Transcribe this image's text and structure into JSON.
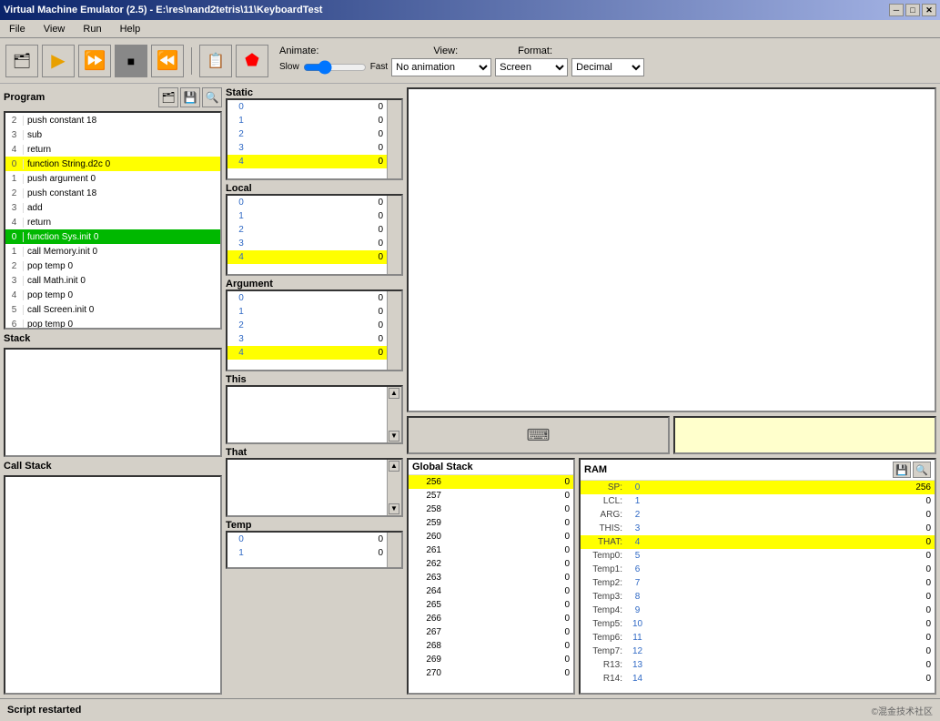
{
  "titlebar": {
    "title": "Virtual Machine Emulator (2.5) - E:\\res\\nand2tetris\\11\\KeyboardTest",
    "minimize": "─",
    "maximize": "□",
    "close": "✕"
  },
  "menu": {
    "items": [
      "File",
      "View",
      "Run",
      "Help"
    ]
  },
  "toolbar": {
    "animate_label": "Animate:",
    "view_label": "View:",
    "format_label": "Format:",
    "slow_label": "Slow",
    "fast_label": "Fast",
    "animate_options": [
      "No animation"
    ],
    "view_options": [
      "Screen"
    ],
    "format_options": [
      "Decimal"
    ]
  },
  "program": {
    "label": "Program",
    "rows": [
      {
        "num": "2",
        "content": "push    constant 18",
        "style": "normal"
      },
      {
        "num": "3",
        "content": "sub",
        "style": "normal"
      },
      {
        "num": "4",
        "content": "return",
        "style": "normal"
      },
      {
        "num": "0",
        "content": "function String.d2c 0",
        "style": "highlight-yellow"
      },
      {
        "num": "1",
        "content": "push    argument 0",
        "style": "normal"
      },
      {
        "num": "2",
        "content": "push    constant 18",
        "style": "normal"
      },
      {
        "num": "3",
        "content": "add",
        "style": "normal"
      },
      {
        "num": "4",
        "content": "return",
        "style": "normal"
      },
      {
        "num": "0",
        "content": "function Sys.init 0",
        "style": "highlight-green"
      },
      {
        "num": "1",
        "content": "call    Memory.init 0",
        "style": "normal"
      },
      {
        "num": "2",
        "content": "pop     temp 0",
        "style": "normal"
      },
      {
        "num": "3",
        "content": "call    Math.init 0",
        "style": "normal"
      },
      {
        "num": "4",
        "content": "pop     temp 0",
        "style": "normal"
      },
      {
        "num": "5",
        "content": "call    Screen.init 0",
        "style": "normal"
      },
      {
        "num": "6",
        "content": "pop     temp 0",
        "style": "normal"
      }
    ]
  },
  "stack": {
    "label": "Stack"
  },
  "call_stack": {
    "label": "Call Stack"
  },
  "static": {
    "label": "Static",
    "rows": [
      {
        "addr": "0",
        "val": "0"
      },
      {
        "addr": "1",
        "val": "0"
      },
      {
        "addr": "2",
        "val": "0"
      },
      {
        "addr": "3",
        "val": "0"
      },
      {
        "addr": "4",
        "val": "0"
      }
    ]
  },
  "local": {
    "label": "Local",
    "rows": [
      {
        "addr": "0",
        "val": "0"
      },
      {
        "addr": "1",
        "val": "0"
      },
      {
        "addr": "2",
        "val": "0"
      },
      {
        "addr": "3",
        "val": "0"
      },
      {
        "addr": "4",
        "val": "0"
      }
    ]
  },
  "argument": {
    "label": "Argument",
    "rows": [
      {
        "addr": "0",
        "val": "0"
      },
      {
        "addr": "1",
        "val": "0"
      },
      {
        "addr": "2",
        "val": "0"
      },
      {
        "addr": "3",
        "val": "0"
      },
      {
        "addr": "4",
        "val": "0"
      }
    ]
  },
  "this": {
    "label": "This"
  },
  "that": {
    "label": "That"
  },
  "temp": {
    "label": "Temp",
    "rows": [
      {
        "addr": "0",
        "val": "0"
      },
      {
        "addr": "1",
        "val": "0"
      }
    ]
  },
  "global_stack": {
    "label": "Global Stack",
    "rows": [
      {
        "addr": "256",
        "val": "0",
        "highlight": true
      },
      {
        "addr": "257",
        "val": "0"
      },
      {
        "addr": "258",
        "val": "0"
      },
      {
        "addr": "259",
        "val": "0"
      },
      {
        "addr": "260",
        "val": "0"
      },
      {
        "addr": "261",
        "val": "0"
      },
      {
        "addr": "262",
        "val": "0"
      },
      {
        "addr": "263",
        "val": "0"
      },
      {
        "addr": "264",
        "val": "0"
      },
      {
        "addr": "265",
        "val": "0"
      },
      {
        "addr": "266",
        "val": "0"
      },
      {
        "addr": "267",
        "val": "0"
      },
      {
        "addr": "268",
        "val": "0"
      },
      {
        "addr": "269",
        "val": "0"
      },
      {
        "addr": "270",
        "val": "0"
      }
    ]
  },
  "ram": {
    "label": "RAM",
    "rows": [
      {
        "label": "SP:",
        "index": "0",
        "val": "256",
        "highlight": true
      },
      {
        "label": "LCL:",
        "index": "1",
        "val": "0"
      },
      {
        "label": "ARG:",
        "index": "2",
        "val": "0"
      },
      {
        "label": "THIS:",
        "index": "3",
        "val": "0"
      },
      {
        "label": "THAT:",
        "index": "4",
        "val": "0",
        "highlight": true
      },
      {
        "label": "Temp0:",
        "index": "5",
        "val": "0"
      },
      {
        "label": "Temp1:",
        "index": "6",
        "val": "0"
      },
      {
        "label": "Temp2:",
        "index": "7",
        "val": "0"
      },
      {
        "label": "Temp3:",
        "index": "8",
        "val": "0"
      },
      {
        "label": "Temp4:",
        "index": "9",
        "val": "0"
      },
      {
        "label": "Temp5:",
        "index": "10",
        "val": "0"
      },
      {
        "label": "Temp6:",
        "index": "11",
        "val": "0"
      },
      {
        "label": "Temp7:",
        "index": "12",
        "val": "0"
      },
      {
        "label": "R13:",
        "index": "13",
        "val": "0"
      },
      {
        "label": "R14:",
        "index": "14",
        "val": "0"
      }
    ]
  },
  "status": {
    "text": "Script restarted"
  },
  "watermark": {
    "text": "©混金技术社区"
  }
}
